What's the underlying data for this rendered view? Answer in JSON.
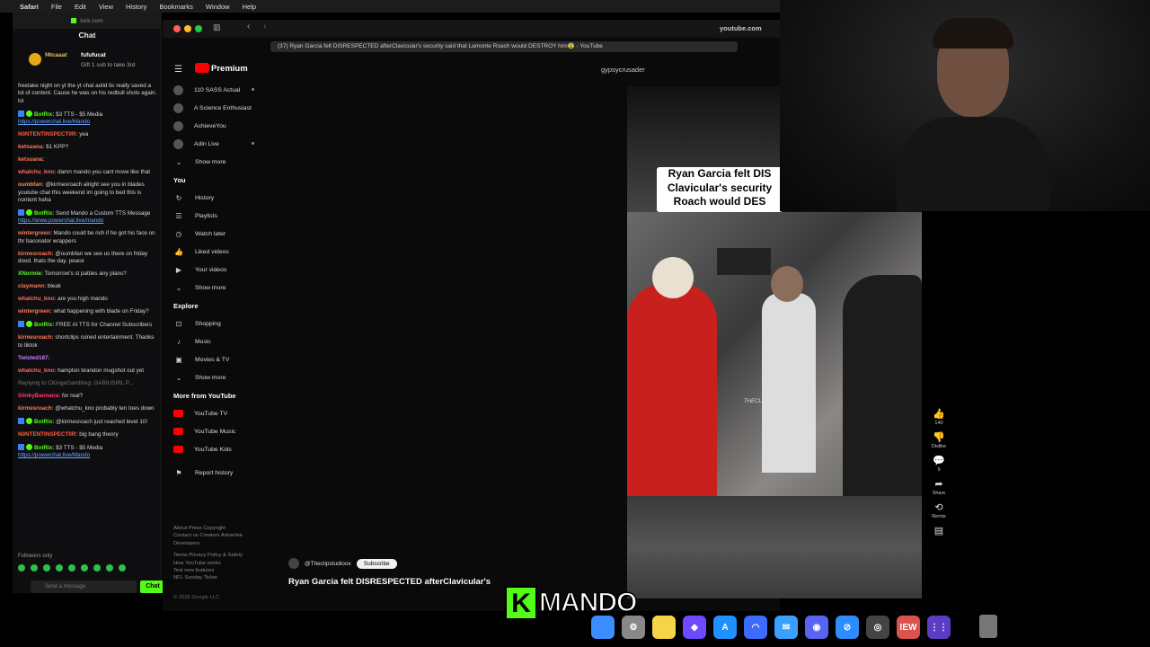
{
  "menubar": {
    "apple": "",
    "app": "Safari",
    "items": [
      "File",
      "Edit",
      "View",
      "History",
      "Bookmarks",
      "Window",
      "Help"
    ]
  },
  "chat": {
    "url": "kick.com",
    "title": "Chat",
    "gift": {
      "user1": "f4tcaaat",
      "count1": "1",
      "user2": "fufufucat",
      "count2": "1",
      "sub_text": "Gift 1 sub to take 3rd"
    },
    "messages": [
      {
        "user": "",
        "text": "freetake night on yt the yt chat aolid tis really saved a lot of content. Cause he was on his redbull shots again. lol",
        "color": "#d8d8d8"
      },
      {
        "user": "BotRix:",
        "text": "$3 TTS - $5 Media",
        "link": "https://powerchat.live/Mando",
        "color": "#53fc18",
        "bot": true
      },
      {
        "user": "N0NTENTINSPECT0R:",
        "text": "yea",
        "color": "#ff5b3a"
      },
      {
        "user": "ketsuana:",
        "text": "$1 KPP?",
        "color": "#ff7b54"
      },
      {
        "user": "ketsuana:",
        "text": "",
        "color": "#ff7b54"
      },
      {
        "user": "whatchu_kno:",
        "text": "damn mando you cant move like that",
        "color": "#ff6a6a"
      },
      {
        "user": "oumbfan:",
        "text": "@kirmesroach alright see you in blades youtube chat this weekend im going to bed this is nontent haha",
        "color": "#ff8c42"
      },
      {
        "user": "BotRix:",
        "text": "Send Mando a Custom TTS Message",
        "link": "https://www.powerchat.live/mando",
        "color": "#53fc18",
        "bot": true
      },
      {
        "user": "wintergreen:",
        "text": "Mando could be rich if he got his face on thr baconator wrappers",
        "color": "#ff7b54"
      },
      {
        "user": "kirmesroach:",
        "text": "@oumbfan we see us there on friday dood. thats the day. peace",
        "color": "#ff7b54"
      },
      {
        "user": "XNormie:",
        "text": "Tomorrow's st patties any plans?",
        "color": "#53fc18"
      },
      {
        "user": "claymann:",
        "text": "bleak",
        "color": "#ff7b54"
      },
      {
        "user": "whatchu_kno:",
        "text": "are you high mando",
        "color": "#ff6a6a"
      },
      {
        "user": "wintergreen:",
        "text": "what happening with blade on Friday?",
        "color": "#ff7b54"
      },
      {
        "user": "BotRix:",
        "text": "FREE AI TTS for Channel Subscribers",
        "color": "#53fc18",
        "bot": true
      },
      {
        "user": "kirmesroach:",
        "text": "shortclips ruined entertainment. Thanks to tiktok",
        "color": "#ff7b54"
      },
      {
        "user": "Twisted187:",
        "text": "",
        "color": "#c77dff"
      },
      {
        "user": "whatchu_kno:",
        "text": "hampton brandon mugshot out yet",
        "color": "#ff6a6a"
      },
      {
        "user": "",
        "text": "Replying to CKingeGambling: GARIUSIRL P...",
        "color": "#777"
      },
      {
        "user": "SlinkyBannana:",
        "text": "for real?",
        "color": "#ff3b6b"
      },
      {
        "user": "kirmesroach:",
        "text": "@whatchu_kno probably ten toes down",
        "color": "#ff7b54"
      },
      {
        "user": "BotRix:",
        "text": "@kirmesroach just reached level 10!",
        "color": "#53fc18",
        "bot": true
      },
      {
        "user": "N0NTENTINSPECT0R:",
        "text": "big bang theory",
        "color": "#ff5b3a"
      },
      {
        "user": "BotRix:",
        "text": "$3 TTS - $5 Media",
        "link": "https://powerchat.live/Mando",
        "color": "#53fc18",
        "bot": true
      }
    ],
    "followers_only": "Followers only",
    "input_placeholder": "Send a message",
    "send_label": "Chat"
  },
  "browser": {
    "url": "youtube.com",
    "tab_title": "(37) Ryan Garcia felt DISRESPECTED afterClavicular's security said that Lamonte Roach would DESTROY him😨 - YouTube"
  },
  "youtube": {
    "logo": "Premium",
    "channel_name": "gypsycrusader",
    "subscriptions": [
      {
        "label": "110 SASS Actual",
        "live": true
      },
      {
        "label": "A Science Enthusiast",
        "live": false
      },
      {
        "label": "AchieveYou",
        "live": false
      },
      {
        "label": "Adin Live",
        "live": true
      }
    ],
    "show_more": "Show more",
    "you_header": "You",
    "you_items": [
      {
        "label": "History",
        "icon": "history-icon",
        "glyph": "↻"
      },
      {
        "label": "Playlists",
        "icon": "playlists-icon",
        "glyph": "☰"
      },
      {
        "label": "Watch later",
        "icon": "clock-icon",
        "glyph": "◷"
      },
      {
        "label": "Liked videos",
        "icon": "thumbs-up-icon",
        "glyph": "👍"
      },
      {
        "label": "Your videos",
        "icon": "video-icon",
        "glyph": "▶"
      }
    ],
    "explore_header": "Explore",
    "explore_items": [
      {
        "label": "Shopping",
        "icon": "bag-icon",
        "glyph": "⊡"
      },
      {
        "label": "Music",
        "icon": "music-icon",
        "glyph": "♪"
      },
      {
        "label": "Movies & TV",
        "icon": "film-icon",
        "glyph": "▣"
      }
    ],
    "more_header": "More from YouTube",
    "more_items": [
      "YouTube TV",
      "YouTube Music",
      "YouTube Kids"
    ],
    "report_history": "Report history",
    "footer_links": [
      "About  Press  Copyright",
      "Contact us  Creators  Advertise",
      "Developers",
      "",
      "Terms  Privacy  Policy & Safety",
      "How YouTube works",
      "Test new features",
      "NFL Sunday Ticket"
    ],
    "copyright": "© 2026 Google LLC",
    "video": {
      "caption_lines": [
        "Ryan Garcia felt DIS",
        "Clavicular's security",
        "Roach would DES"
      ],
      "watermark": "THECLIPSTUDIO",
      "channel": "@Theclipstudioox",
      "subscribe": "Subscribe",
      "title": "Ryan Garcia felt DISRESPECTED afterClavicular's"
    },
    "actions": [
      {
        "icon": "like-icon",
        "glyph": "👍",
        "label": "140"
      },
      {
        "icon": "dislike-icon",
        "glyph": "👎",
        "label": "Dislike"
      },
      {
        "icon": "comment-icon",
        "glyph": "💬",
        "label": "9"
      },
      {
        "icon": "share-icon",
        "glyph": "➦",
        "label": "Share"
      },
      {
        "icon": "remix-icon",
        "glyph": "⟲",
        "label": "Remix"
      },
      {
        "icon": "more-icon",
        "glyph": "▤",
        "label": ""
      }
    ]
  },
  "overlay": {
    "k": "K",
    "mando": "MANDO"
  },
  "dock": [
    {
      "name": "finder-icon",
      "color": "#3b8cff",
      "glyph": ""
    },
    {
      "name": "settings-icon",
      "color": "#888",
      "glyph": "⚙"
    },
    {
      "name": "notes-icon",
      "color": "#f5d547",
      "glyph": ""
    },
    {
      "name": "proton-icon",
      "color": "#6d4aff",
      "glyph": "◆"
    },
    {
      "name": "appstore-icon",
      "color": "#1e90ff",
      "glyph": "A"
    },
    {
      "name": "arc-icon",
      "color": "#3b6cff",
      "glyph": "◠"
    },
    {
      "name": "mail-icon",
      "color": "#3aa0ff",
      "glyph": "✉"
    },
    {
      "name": "discord-icon",
      "color": "#5865f2",
      "glyph": "◉"
    },
    {
      "name": "safari-icon",
      "color": "#2f8cff",
      "glyph": "⊘"
    },
    {
      "name": "chrome-icon",
      "color": "#444",
      "glyph": "◎"
    },
    {
      "name": "iew-icon",
      "color": "#d9534f",
      "glyph": "IEW"
    },
    {
      "name": "launchpad-icon",
      "color": "#5b3cc4",
      "glyph": "⋮⋮"
    }
  ]
}
